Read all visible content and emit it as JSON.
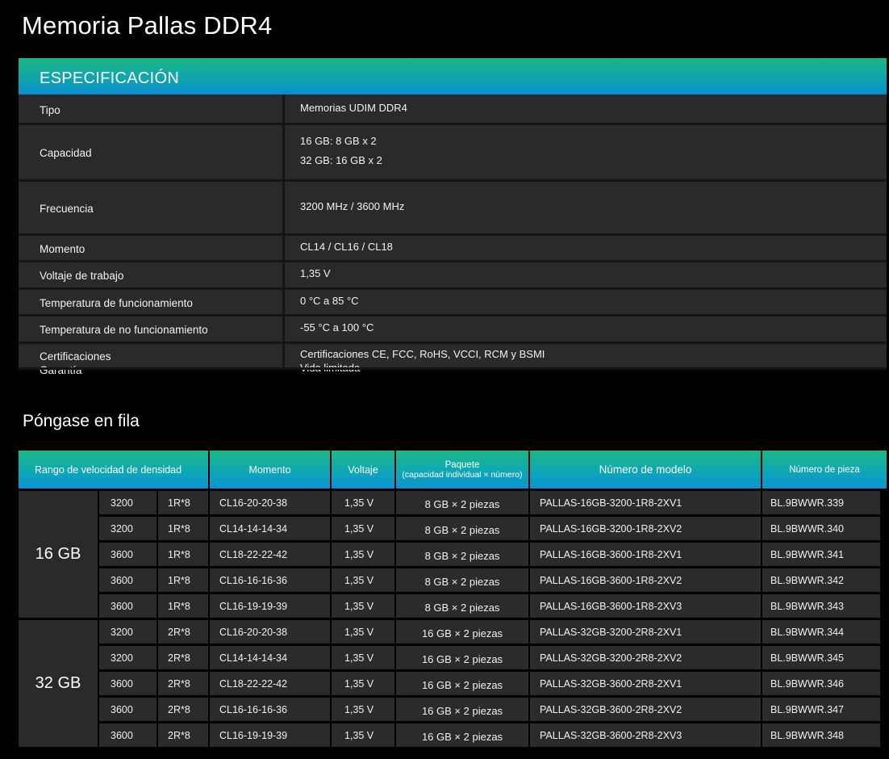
{
  "page_title": "Memoria Pallas DDR4",
  "spec": {
    "header": "ESPECIFICACIÓN",
    "rows": [
      {
        "label": "Tipo",
        "values": [
          "Memorias UDIM DDR4"
        ]
      },
      {
        "label": "Capacidad",
        "values": [
          "16 GB: 8 GB x 2",
          "32 GB: 16 GB x 2"
        ]
      },
      {
        "label": "Frecuencia",
        "values": [
          "3200 MHz / 3600 MHz"
        ]
      },
      {
        "label": "Momento",
        "values": [
          "CL14 / CL16 / CL18"
        ]
      },
      {
        "label": "Voltaje de trabajo",
        "values": [
          "1,35 V"
        ]
      },
      {
        "label": "Temperatura de funcionamiento",
        "values": [
          "0 °C a 85 °C"
        ]
      },
      {
        "label": "Temperatura de no funcionamiento",
        "values": [
          "-55 °C a 100 °C"
        ]
      },
      {
        "label": "Certificaciones",
        "values": [
          "Certificaciones CE, FCC, RoHS, VCCI, RCM y BSMI"
        ]
      },
      {
        "label": "Garantía",
        "values": [
          "Vida limitada"
        ]
      }
    ]
  },
  "lineup": {
    "title": "Póngase en fila",
    "headers": {
      "range": "Rango de velocidad de densidad",
      "timing": "Momento",
      "voltage": "Voltaje",
      "package": "Paquete",
      "package_sub": "(capacidad individual × número)",
      "model": "Número de modelo",
      "part": "Número de pieza"
    },
    "groups": [
      {
        "capacity": "16 GB",
        "rows": [
          [
            "3200",
            "1R*8",
            "CL16-20-20-38",
            "1,35 V",
            "8 GB × 2 piezas",
            "PALLAS-16GB-3200-1R8-2XV1",
            "BL.9BWWR.339"
          ],
          [
            "3200",
            "1R*8",
            "CL14-14-14-34",
            "1,35 V",
            "8 GB × 2 piezas",
            "PALLAS-16GB-3200-1R8-2XV2",
            "BL.9BWWR.340"
          ],
          [
            "3600",
            "1R*8",
            "CL18-22-22-42",
            "1,35 V",
            "8 GB × 2 piezas",
            "PALLAS-16GB-3600-1R8-2XV1",
            "BL.9BWWR.341"
          ],
          [
            "3600",
            "1R*8",
            "CL16-16-16-36",
            "1,35 V",
            "8 GB × 2 piezas",
            "PALLAS-16GB-3600-1R8-2XV2",
            "BL.9BWWR.342"
          ],
          [
            "3600",
            "1R*8",
            "CL16-19-19-39",
            "1,35 V",
            "8 GB × 2 piezas",
            "PALLAS-16GB-3600-1R8-2XV3",
            "BL.9BWWR.343"
          ]
        ]
      },
      {
        "capacity": "32 GB",
        "rows": [
          [
            "3200",
            "2R*8",
            "CL16-20-20-38",
            "1,35 V",
            "16 GB × 2 piezas",
            "PALLAS-32GB-3200-2R8-2XV1",
            "BL.9BWWR.344"
          ],
          [
            "3200",
            "2R*8",
            "CL14-14-14-34",
            "1,35 V",
            "16 GB × 2 piezas",
            "PALLAS-32GB-3200-2R8-2XV2",
            "BL.9BWWR.345"
          ],
          [
            "3600",
            "2R*8",
            "CL18-22-22-42",
            "1,35 V",
            "16 GB × 2 piezas",
            "PALLAS-32GB-3600-2R8-2XV1",
            "BL.9BWWR.346"
          ],
          [
            "3600",
            "2R*8",
            "CL16-16-16-36",
            "1,35 V",
            "16 GB × 2 piezas",
            "PALLAS-32GB-3600-2R8-2XV2",
            "BL.9BWWR.347"
          ],
          [
            "3600",
            "2R*8",
            "CL16-19-19-39",
            "1,35 V",
            "16 GB × 2 piezas",
            "PALLAS-32GB-3600-2R8-2XV3",
            "BL.9BWWR.348"
          ]
        ]
      }
    ]
  }
}
